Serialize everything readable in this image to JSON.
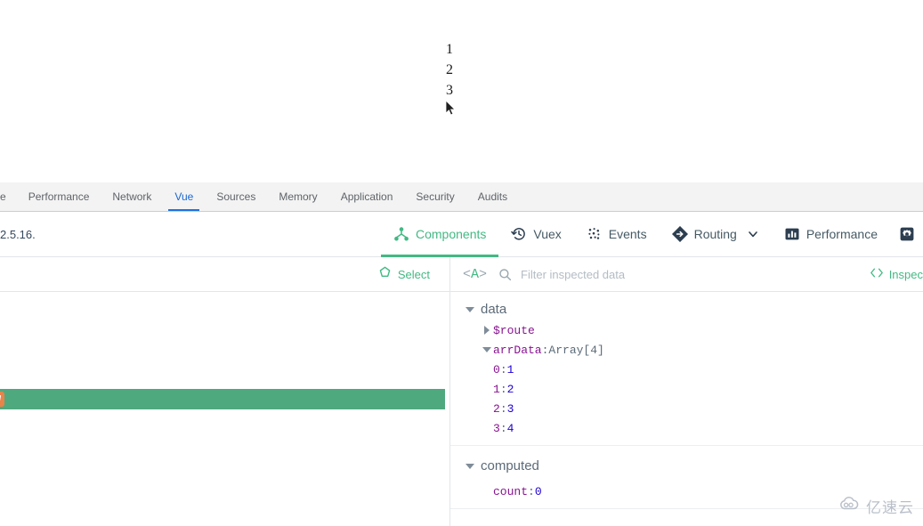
{
  "page": {
    "list_items": [
      "1",
      "2",
      "3"
    ],
    "cursor_icon": "mouse-pointer-icon"
  },
  "devtools": {
    "tabs": [
      {
        "label": "e",
        "active": false,
        "truncated": true
      },
      {
        "label": "Performance",
        "active": false
      },
      {
        "label": "Network",
        "active": false
      },
      {
        "label": "Vue",
        "active": true
      },
      {
        "label": "Sources",
        "active": false
      },
      {
        "label": "Memory",
        "active": false
      },
      {
        "label": "Application",
        "active": false
      },
      {
        "label": "Security",
        "active": false
      },
      {
        "label": "Audits",
        "active": false
      }
    ],
    "active_tab_color": "#1a73e8"
  },
  "vue_toolbar": {
    "version": "2.5.16.",
    "items": [
      {
        "label": "Components",
        "icon": "components-icon",
        "active": true
      },
      {
        "label": "Vuex",
        "icon": "history-clock-icon",
        "active": false
      },
      {
        "label": "Events",
        "icon": "events-dots-icon",
        "active": false
      },
      {
        "label": "Routing",
        "icon": "routing-diamond-icon",
        "active": false,
        "chevron": "chevron-down-icon"
      },
      {
        "label": "Performance",
        "icon": "bar-chart-icon",
        "active": false
      }
    ],
    "settings_icon": "gear-icon",
    "accent_color": "#42b983"
  },
  "component_tree": {
    "select_label": "Select",
    "select_icon": "target-select-icon",
    "selected_row": {
      "badge_label": "ew",
      "badge_color": "#e8834a",
      "row_color": "#4fa97f"
    }
  },
  "inspector": {
    "tag_icon": "<A>",
    "search_icon": "search-icon",
    "filter_placeholder": "Filter inspected data",
    "filter_value": "",
    "inspect_link_label": "Inspec",
    "inspect_link_icon": "code-brackets-icon",
    "sections": [
      {
        "name": "data",
        "expanded": true,
        "rows": [
          {
            "twisty": "right",
            "key": "$route",
            "sep": "",
            "value": "",
            "indent": 1
          },
          {
            "twisty": "down",
            "key": "arrData",
            "sep": ": ",
            "value": "Array[4]",
            "value_kind": "meta",
            "indent": 1
          },
          {
            "twisty": "",
            "key": "0",
            "sep": ": ",
            "value": "1",
            "value_kind": "num",
            "indent": 2
          },
          {
            "twisty": "",
            "key": "1",
            "sep": ": ",
            "value": "2",
            "value_kind": "num",
            "indent": 2
          },
          {
            "twisty": "",
            "key": "2",
            "sep": ": ",
            "value": "3",
            "value_kind": "num",
            "indent": 2
          },
          {
            "twisty": "",
            "key": "3",
            "sep": ": ",
            "value": "4",
            "value_kind": "num",
            "indent": 2
          }
        ]
      },
      {
        "name": "computed",
        "expanded": true,
        "rows": [
          {
            "twisty": "",
            "key": "count",
            "sep": ": ",
            "value": "0",
            "value_kind": "num",
            "indent": 2
          }
        ]
      }
    ]
  },
  "watermark": {
    "text": "亿速云",
    "icon": "cloud-logo-icon"
  }
}
